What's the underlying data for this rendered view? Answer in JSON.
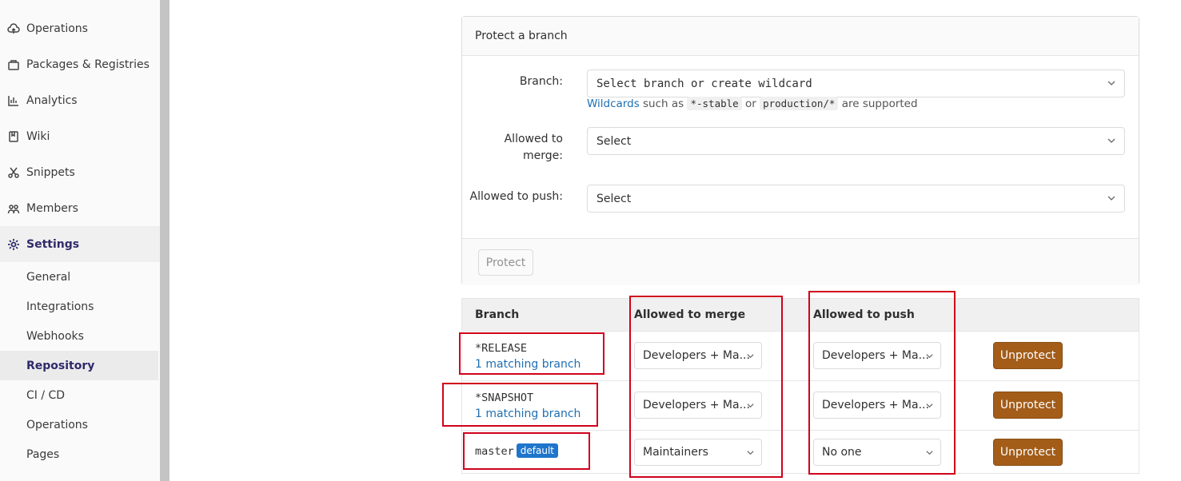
{
  "sidebar": {
    "items": [
      {
        "label": "Operations",
        "icon": "cloud-icon"
      },
      {
        "label": "Packages & Registries",
        "icon": "package-icon"
      },
      {
        "label": "Analytics",
        "icon": "chart-icon"
      },
      {
        "label": "Wiki",
        "icon": "book-icon"
      },
      {
        "label": "Snippets",
        "icon": "scissors-icon"
      },
      {
        "label": "Members",
        "icon": "users-icon"
      },
      {
        "label": "Settings",
        "icon": "gear-icon"
      }
    ],
    "settings_sub": [
      "General",
      "Integrations",
      "Webhooks",
      "Repository",
      "CI / CD",
      "Operations",
      "Pages"
    ],
    "active_sub": "Repository"
  },
  "protect_form": {
    "title": "Protect a branch",
    "branch_label": "Branch:",
    "branch_placeholder": "Select branch or create wildcard",
    "help_link": "Wildcards",
    "help_text1": " such as ",
    "help_code1": "*-stable",
    "help_text2": " or ",
    "help_code2": "production/*",
    "help_text3": " are supported",
    "merge_label_1": "Allowed to",
    "merge_label_2": "merge:",
    "merge_value": "Select",
    "push_label": "Allowed to push:",
    "push_value": "Select",
    "protect_button": "Protect"
  },
  "table": {
    "headers": {
      "branch": "Branch",
      "merge": "Allowed to merge",
      "push": "Allowed to push"
    },
    "rows": [
      {
        "branch": "*RELEASE",
        "matching": "1 matching branch",
        "merge": "Developers + Ma...",
        "push": "Developers + Ma...",
        "action": "Unprotect"
      },
      {
        "branch": "*SNAPSHOT",
        "matching": "1 matching branch",
        "merge": "Developers + Ma...",
        "push": "Developers + Ma...",
        "action": "Unprotect"
      },
      {
        "branch": "master",
        "badge": "default",
        "merge": "Maintainers",
        "push": "No one",
        "action": "Unprotect"
      }
    ]
  },
  "colors": {
    "accent": "#2f2a6b",
    "link": "#1f6fb2",
    "unprotect": "#a35d19",
    "annotation": "#d0021b"
  }
}
